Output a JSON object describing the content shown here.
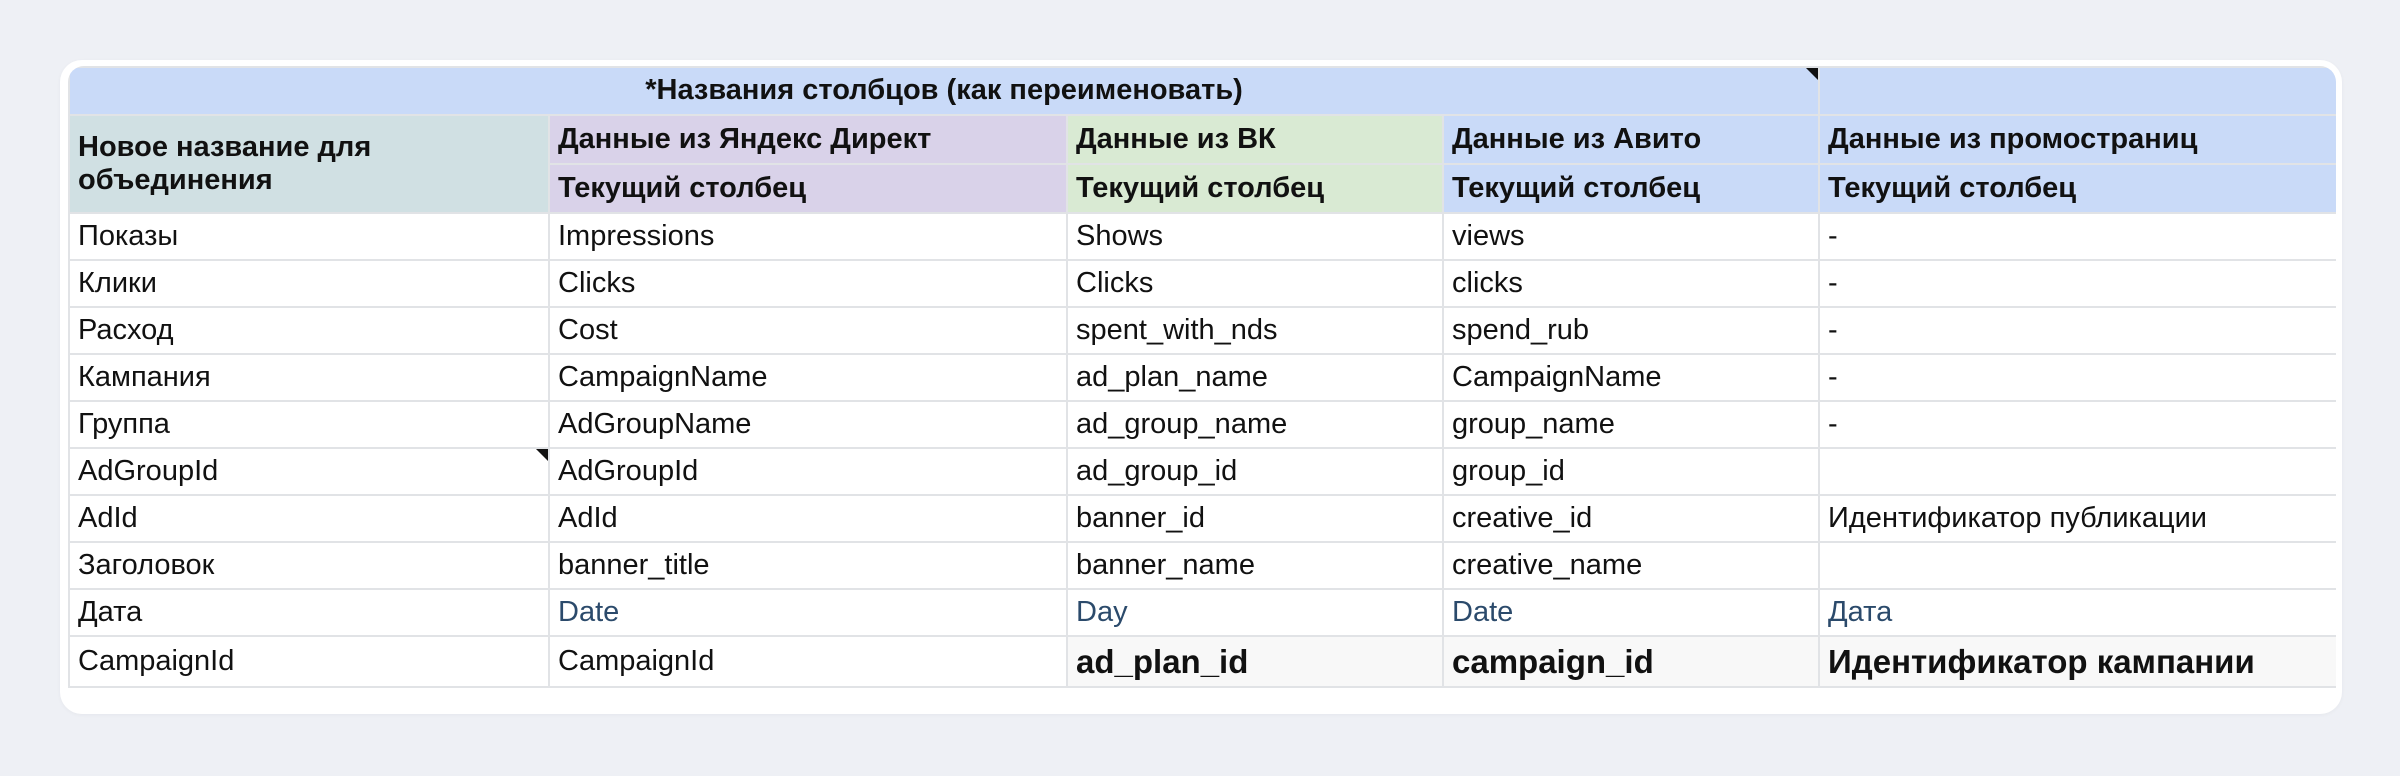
{
  "table": {
    "title": "*Названия столбцов  (как переименовать)",
    "group_headers": [
      "Новое название для объединения",
      "Данные из Яндекс Директ",
      "Данные из ВК",
      "Данные из Авито",
      "Данные из промостраниц"
    ],
    "sub_headers": [
      "Текущий столбец",
      "Текущий столбец",
      "Текущий столбец",
      "Текущий столбец"
    ],
    "rows": [
      [
        "Показы",
        "Impressions",
        "Shows",
        "views",
        "-"
      ],
      [
        "Клики",
        "Clicks",
        "Clicks",
        "clicks",
        "-"
      ],
      [
        "Расход",
        "Cost",
        "spent_with_nds",
        "spend_rub",
        "-"
      ],
      [
        "Кампания",
        "CampaignName",
        "ad_plan_name",
        "CampaignName",
        "-"
      ],
      [
        "Группа",
        "AdGroupName",
        "ad_group_name",
        "group_name",
        "-"
      ],
      [
        "AdGroupId",
        "AdGroupId",
        "ad_group_id",
        "group_id",
        ""
      ],
      [
        "AdId",
        "AdId",
        "banner_id",
        "creative_id",
        "Идентификатор публикации"
      ],
      [
        "Заголовок",
        "banner_title",
        "banner_name",
        "creative_name",
        ""
      ],
      [
        "Дата",
        "Date",
        "Day",
        "Date",
        "Дата"
      ],
      [
        "CampaignId",
        "CampaignId",
        "ad_plan_id",
        "campaign_id",
        "Идентификатор кампании"
      ]
    ]
  },
  "colors": {
    "page_bg": "#eef0f5",
    "title_bg": "#c9daf8",
    "first_col_header_bg": "#d0e0e3",
    "yandex_header_bg": "#d9d2e9",
    "vk_header_bg": "#d9ead3",
    "avito_header_bg": "#c9daf8",
    "promo_header_bg": "#c9daf8",
    "grid_line": "#e1e3e6",
    "date_text": "#2b4a6b"
  }
}
